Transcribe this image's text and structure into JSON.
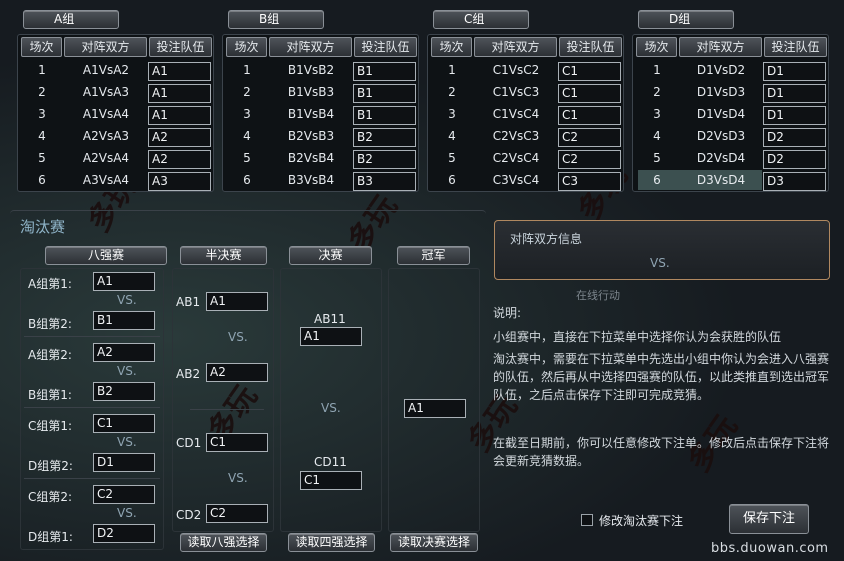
{
  "groups": [
    {
      "name": "A组",
      "header": {
        "round": "场次",
        "match": "对阵双方",
        "bet": "投注队伍"
      },
      "rows": [
        {
          "n": "1",
          "m": "A1VsA2",
          "b": "A1"
        },
        {
          "n": "2",
          "m": "A1VsA3",
          "b": "A1"
        },
        {
          "n": "3",
          "m": "A1VsA4",
          "b": "A1"
        },
        {
          "n": "4",
          "m": "A2VsA3",
          "b": "A2"
        },
        {
          "n": "5",
          "m": "A2VsA4",
          "b": "A2"
        },
        {
          "n": "6",
          "m": "A3VsA4",
          "b": "A3"
        }
      ]
    },
    {
      "name": "B组",
      "header": {
        "round": "场次",
        "match": "对阵双方",
        "bet": "投注队伍"
      },
      "rows": [
        {
          "n": "1",
          "m": "B1VsB2",
          "b": "B1"
        },
        {
          "n": "2",
          "m": "B1VsB3",
          "b": "B1"
        },
        {
          "n": "3",
          "m": "B1VsB4",
          "b": "B1"
        },
        {
          "n": "4",
          "m": "B2VsB3",
          "b": "B2"
        },
        {
          "n": "5",
          "m": "B2VsB4",
          "b": "B2"
        },
        {
          "n": "6",
          "m": "B3VsB4",
          "b": "B3"
        }
      ]
    },
    {
      "name": "C组",
      "header": {
        "round": "场次",
        "match": "对阵双方",
        "bet": "投注队伍"
      },
      "rows": [
        {
          "n": "1",
          "m": "C1VsC2",
          "b": "C1"
        },
        {
          "n": "2",
          "m": "C1VsC3",
          "b": "C1"
        },
        {
          "n": "3",
          "m": "C1VsC4",
          "b": "C1"
        },
        {
          "n": "4",
          "m": "C2VsC3",
          "b": "C2"
        },
        {
          "n": "5",
          "m": "C2VsC4",
          "b": "C2"
        },
        {
          "n": "6",
          "m": "C3VsC4",
          "b": "C3"
        }
      ]
    },
    {
      "name": "D组",
      "header": {
        "round": "场次",
        "match": "对阵双方",
        "bet": "投注队伍"
      },
      "rows": [
        {
          "n": "1",
          "m": "D1VsD2",
          "b": "D1"
        },
        {
          "n": "2",
          "m": "D1VsD3",
          "b": "D1"
        },
        {
          "n": "3",
          "m": "D1VsD4",
          "b": "D1"
        },
        {
          "n": "4",
          "m": "D2VsD3",
          "b": "D2"
        },
        {
          "n": "5",
          "m": "D2VsD4",
          "b": "D2"
        },
        {
          "n": "6",
          "m": "D3VsD4",
          "b": "D3"
        }
      ]
    }
  ],
  "knockout": {
    "title": "淘汰赛",
    "tabs": {
      "top8": "八强赛",
      "semi": "半决赛",
      "final": "决赛",
      "champ": "冠军"
    },
    "top8": [
      {
        "l1": "A组第1:",
        "v1": "A1",
        "l2": "B组第2:",
        "v2": "B1"
      },
      {
        "l1": "A组第2:",
        "v1": "A2",
        "l2": "B组第1:",
        "v2": "B2"
      },
      {
        "l1": "C组第1:",
        "v1": "C1",
        "l2": "D组第2:",
        "v2": "D1"
      },
      {
        "l1": "C组第2:",
        "v1": "C2",
        "l2": "D组第1:",
        "v2": "D2"
      }
    ],
    "semi": [
      {
        "l1": "AB1",
        "v1": "A1",
        "l2": "AB2",
        "v2": "A2"
      },
      {
        "l1": "CD1",
        "v1": "C1",
        "l2": "CD2",
        "v2": "C2"
      }
    ],
    "final": {
      "l1": "AB11",
      "v1": "A1",
      "l2": "CD11",
      "v2": "C1"
    },
    "champion": "A1",
    "vs": "VS.",
    "buttons": {
      "read_top8": "读取八强选择",
      "read_top4": "读取四强选择",
      "read_final": "读取决赛选择"
    }
  },
  "info": {
    "title": "对阵双方信息",
    "vs": "VS."
  },
  "notes": {
    "heading": "说明:",
    "p1": "小组赛中，直接在下拉菜单中选择你认为会获胜的队伍",
    "p2": "淘汰赛中，需要在下拉菜单中先选出小组中你认为会进入八强赛的队伍，然后再从中选择四强赛的队伍，以此类推直到选出冠军队伍，之后点击保存下注即可完成竞猜。",
    "p3": "在截至日期前，你可以任意修改下注单。修改后点击保存下注将会更新竞猜数据。"
  },
  "modify_label": "修改淘汰赛下注",
  "save_label": "保存下注",
  "bg_hint": "在线行动",
  "footer": "bbs.duowan.com",
  "colors": {
    "highlight": "#3c5050",
    "vs": "#8fa4b2"
  }
}
